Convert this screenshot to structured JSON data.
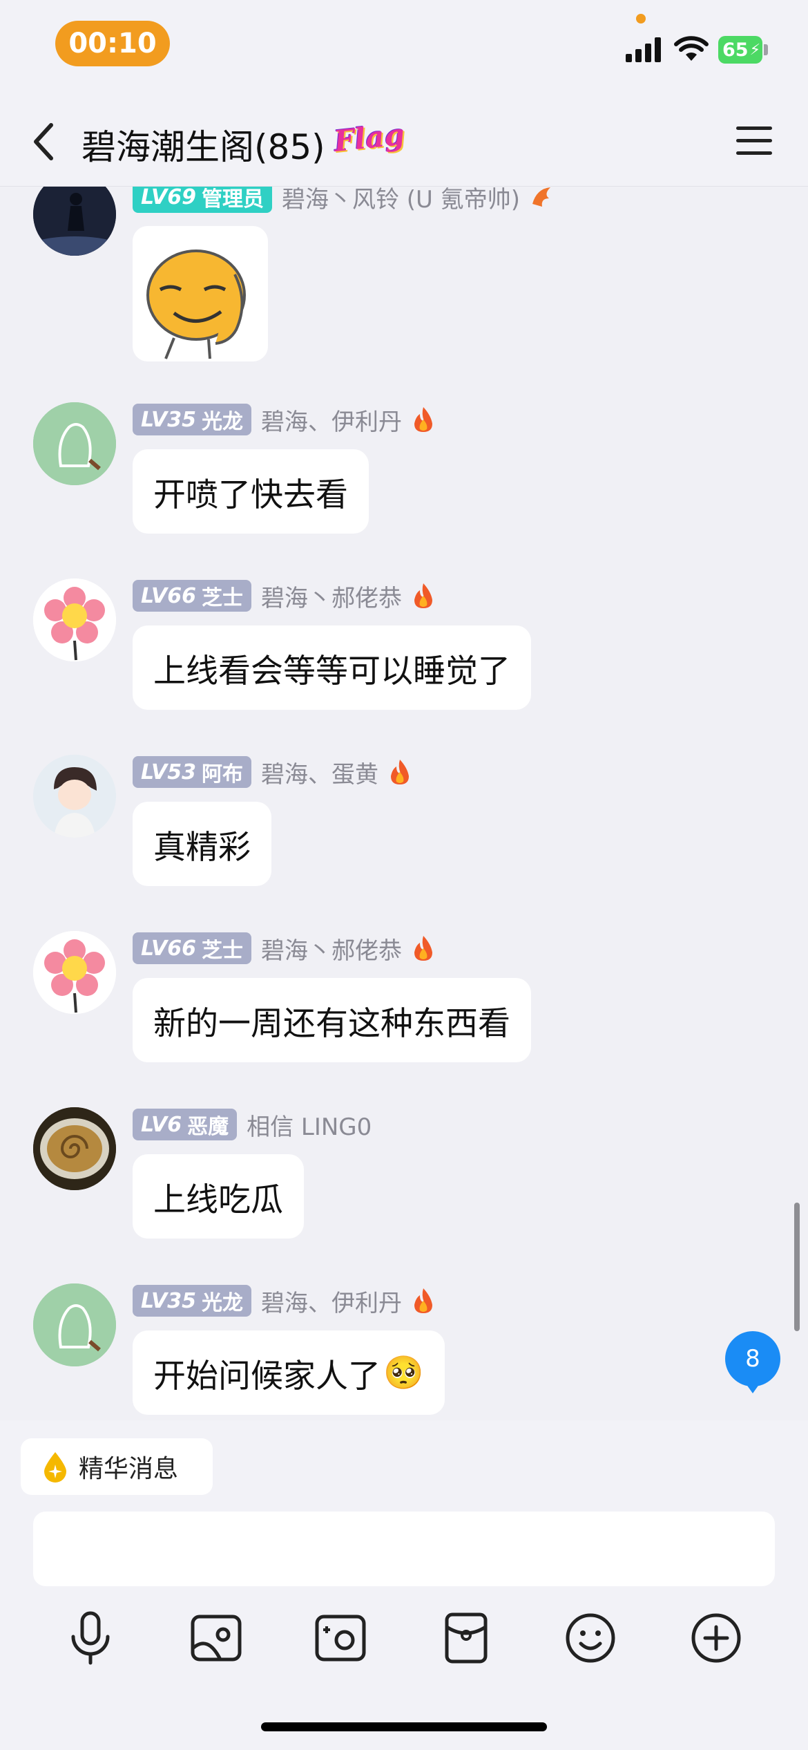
{
  "status_bar": {
    "time": "00:10",
    "battery": "65"
  },
  "nav": {
    "title": "碧海潮生阁(85)",
    "badge": "Flag"
  },
  "messages": [
    {
      "level": "LV69",
      "title": "管理员",
      "sender": "碧海丶风铃 (U 氪帝帅)",
      "type": "sticker"
    },
    {
      "level": "LV35",
      "title": "光龙",
      "sender": "碧海、伊利丹",
      "text": "开喷了快去看"
    },
    {
      "level": "LV66",
      "title": "芝士",
      "sender": "碧海丶郝佬恭",
      "text": "上线看会等等可以睡觉了"
    },
    {
      "level": "LV53",
      "title": "阿布",
      "sender": "碧海、蛋黄",
      "text": "真精彩"
    },
    {
      "level": "LV66",
      "title": "芝士",
      "sender": "碧海丶郝佬恭",
      "text": "新的一周还有这种东西看"
    },
    {
      "level": "LV6",
      "title": "恶魔",
      "sender": "相信 LING0",
      "text": "上线吃瓜"
    },
    {
      "level": "LV35",
      "title": "光龙",
      "sender": "碧海、伊利丹",
      "text": "开始问候家人了",
      "emoji": "🥺"
    }
  ],
  "unread_count": "8",
  "essence_label": "精华消息",
  "toolbar": [
    "mic-icon",
    "image-icon",
    "camera-icon",
    "red-packet-icon",
    "emoji-icon",
    "plus-icon"
  ]
}
